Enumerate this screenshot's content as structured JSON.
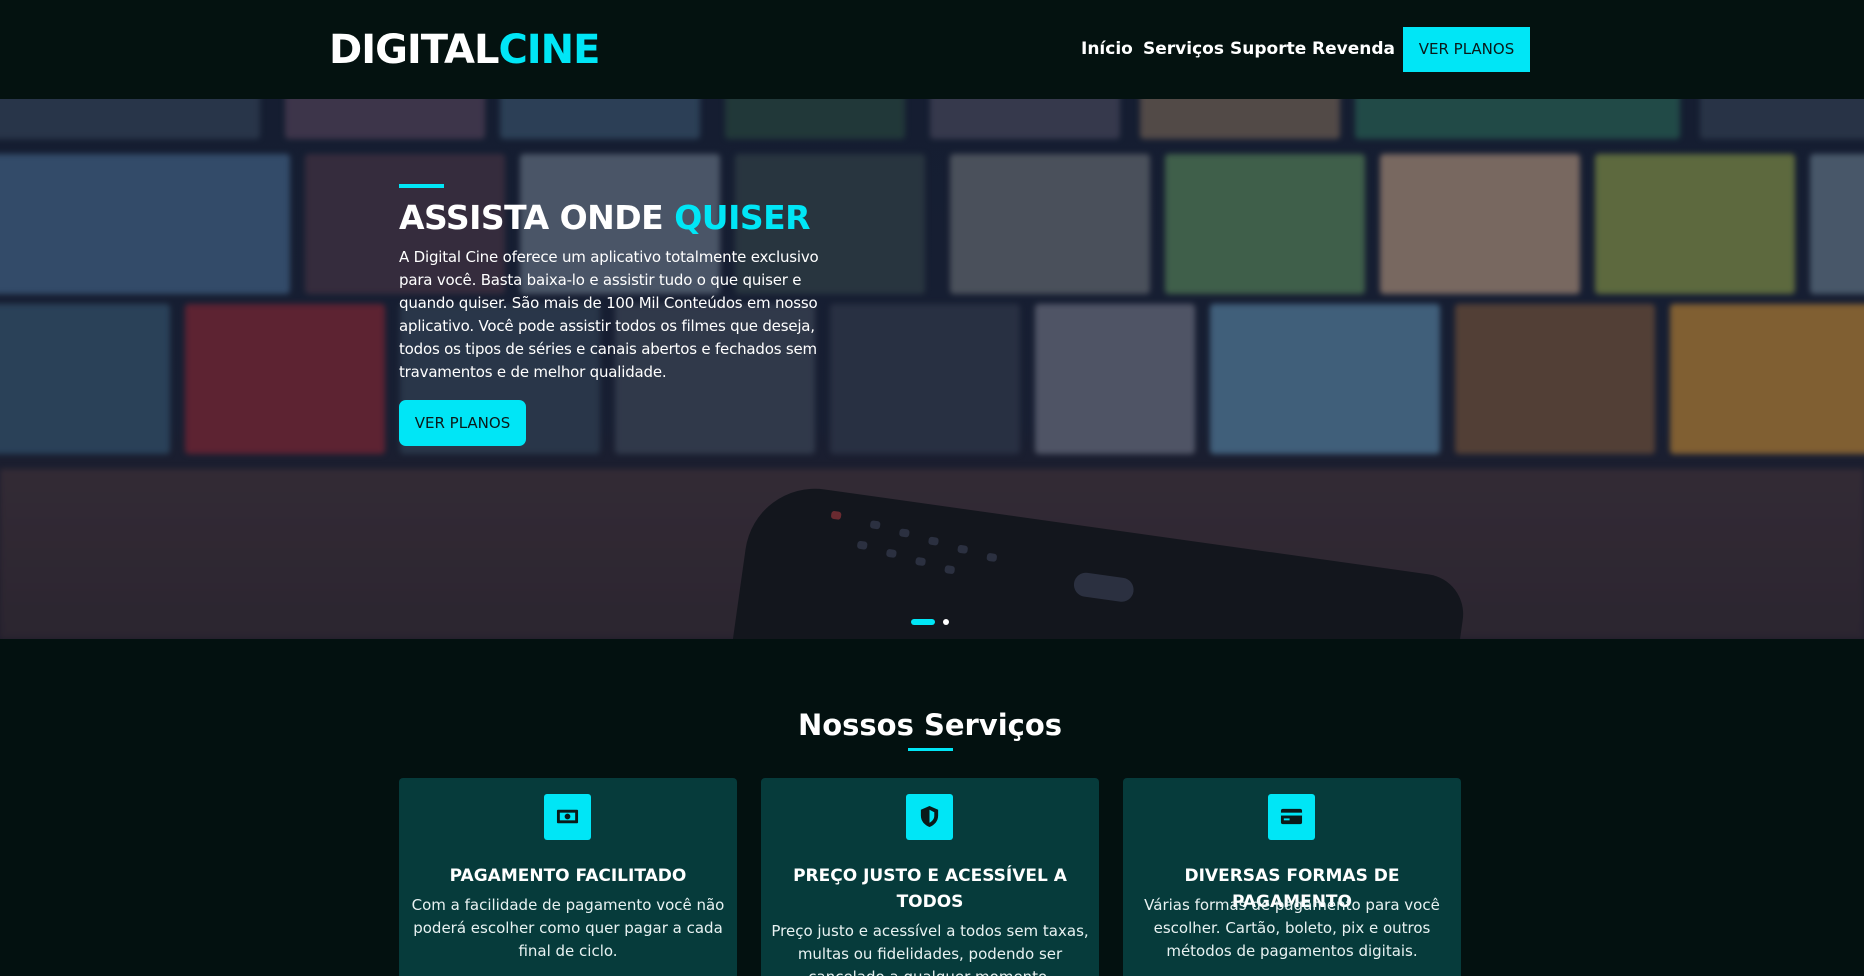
{
  "header": {
    "logo_part1": "DIGITAL",
    "logo_part2": "CINE",
    "nav": [
      "Início",
      "Serviços",
      "Suporte",
      "Revenda"
    ],
    "cta_label": "VER PLANOS"
  },
  "hero": {
    "title_part1": "ASSISTA ONDE",
    "title_part2": "QUISER",
    "description": "A Digital Cine oferece um aplicativo totalmente exclusivo para você. Basta baixa-lo e assistir tudo o que quiser e quando quiser. São mais de 100 Mil Conteúdos em nosso aplicativo. Você pode assistir todos os filmes que deseja, todos os tipos de séries e canais abertos e fechados sem travamentos e de melhor qualidade.",
    "button_label": "VER PLANOS",
    "slides_count": 2,
    "active_slide": 1
  },
  "services": {
    "title": "Nossos Serviços",
    "cards": [
      {
        "icon": "money-icon",
        "title": "PAGAMENTO FACILITADO",
        "text": "Com a facilidade de pagamento você não poderá escolher como quer pagar a cada final de ciclo."
      },
      {
        "icon": "shield-icon",
        "title": "PREÇO JUSTO E ACESSÍVEL A TODOS",
        "text": "Preço justo e acessível a todos sem taxas, multas ou fidelidades, podendo ser cancelado a qualquer momento."
      },
      {
        "icon": "credit-card-icon",
        "title": "DIVERSAS FORMAS DE PAGAMENTO",
        "text": "Várias formas de pagamento para você escolher. Cartão, boleto, pix e outros métodos de pagamentos digitais."
      }
    ]
  },
  "colors": {
    "accent": "#00e6f6",
    "background": "#041210",
    "card": "#063b3b"
  }
}
